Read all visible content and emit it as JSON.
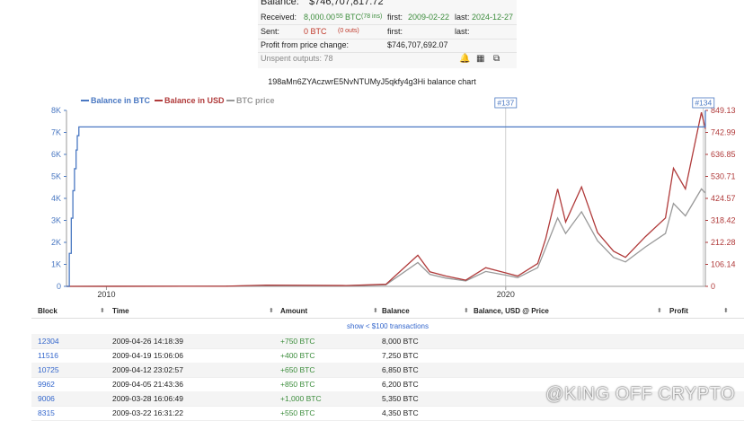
{
  "summary": {
    "balance_label": "Balance:",
    "balance_value": "$746,707,817.72",
    "received_label": "Received:",
    "received_value": "8,000.00",
    "received_suffix": "55",
    "received_unit": "BTC",
    "received_ins": "(78 ins)",
    "received_first_label": "first:",
    "received_first": "2009-02-22",
    "received_last_label": "last:",
    "received_last": "2024-12-27",
    "sent_label": "Sent:",
    "sent_value": "0 BTC",
    "sent_outs": "(0 outs)",
    "sent_first_label": "first:",
    "sent_last_label": "last:",
    "profit_label": "Profit from price change:",
    "profit_value": "$746,707,692.07",
    "unspent_label": "Unspent outputs: 78",
    "icons": [
      "bell-icon",
      "qr-code-icon",
      "copy-icon"
    ],
    "icon_glyphs": [
      "🔔",
      "▦",
      "⧉"
    ]
  },
  "chart_title": "198aMn6ZYAczwrE5NvNTUMyJ5qkfy4g3Hi balance chart",
  "chart_data": {
    "type": "line",
    "legend": [
      {
        "name": "Balance in BTC",
        "color": "#4a78c2"
      },
      {
        "name": "Balance in USD",
        "color": "#b03a3a"
      },
      {
        "name": "BTC price",
        "color": "#999999"
      }
    ],
    "legend_placement": "top-left",
    "x_ticks": [
      "2010",
      "2020"
    ],
    "x_range": [
      2009.0,
      2025.0
    ],
    "y_left_ticks": [
      "0",
      "1K",
      "2K",
      "3K",
      "4K",
      "5K",
      "6K",
      "7K",
      "8K"
    ],
    "y_left_range": [
      0,
      8000
    ],
    "y_right_ticks": [
      "0",
      "106.14",
      "212.28",
      "318.42",
      "424.57",
      "530.71",
      "636.85",
      "742.99",
      "849.13"
    ],
    "y_right_range": [
      0,
      849.13
    ],
    "y_right_unit": "M",
    "annotations": [
      "#137",
      "#134"
    ],
    "annotation_x": [
      2020.0,
      2024.95
    ],
    "grid": false,
    "series": [
      {
        "name": "Balance in BTC",
        "axis": "left",
        "x": [
          2009.0,
          2009.07,
          2009.12,
          2009.16,
          2009.2,
          2009.24,
          2009.27,
          2009.31,
          2025.0
        ],
        "values": [
          0,
          1500,
          3100,
          4350,
          5350,
          6200,
          6850,
          7250,
          8000
        ]
      },
      {
        "name": "Balance in USD",
        "axis": "right",
        "x": [
          2009.0,
          2012.0,
          2013.0,
          2014.0,
          2016.0,
          2017.0,
          2017.8,
          2018.1,
          2018.5,
          2019.0,
          2019.5,
          2020.0,
          2020.3,
          2020.8,
          2021.0,
          2021.3,
          2021.5,
          2021.9,
          2022.3,
          2022.7,
          2023.0,
          2023.5,
          2024.0,
          2024.2,
          2024.5,
          2024.9,
          2025.0
        ],
        "values": [
          0,
          0.5,
          1,
          6,
          4,
          10,
          150,
          70,
          50,
          30,
          90,
          65,
          50,
          110,
          230,
          470,
          310,
          480,
          260,
          170,
          140,
          240,
          330,
          570,
          470,
          840,
          760
        ]
      },
      {
        "name": "BTC price",
        "axis": "right",
        "x": [
          2009.0,
          2012.0,
          2013.0,
          2014.0,
          2016.0,
          2017.0,
          2017.8,
          2018.1,
          2018.5,
          2019.0,
          2019.5,
          2020.0,
          2020.3,
          2020.8,
          2021.0,
          2021.3,
          2021.5,
          2021.9,
          2022.3,
          2022.7,
          2023.0,
          2023.5,
          2024.0,
          2024.2,
          2024.5,
          2024.9,
          2025.0
        ],
        "values": [
          0,
          0.4,
          0.8,
          4,
          3,
          8,
          115,
          58,
          40,
          26,
          72,
          54,
          42,
          90,
          185,
          330,
          255,
          360,
          220,
          140,
          118,
          190,
          255,
          400,
          340,
          470,
          450
        ]
      }
    ]
  },
  "table": {
    "headers": [
      "Block",
      "Time",
      "Amount",
      "Balance",
      "Balance, USD @ Price",
      "Profit"
    ],
    "show_link": "show < $100 transactions",
    "rows": [
      {
        "block": "12304",
        "time": "2009-04-26 14:18:39",
        "amount": "+750 BTC",
        "balance": "8,000 BTC"
      },
      {
        "block": "11516",
        "time": "2009-04-19 15:06:06",
        "amount": "+400 BTC",
        "balance": "7,250 BTC"
      },
      {
        "block": "10725",
        "time": "2009-04-12 23:02:57",
        "amount": "+650 BTC",
        "balance": "6,850 BTC"
      },
      {
        "block": "9962",
        "time": "2009-04-05 21:43:36",
        "amount": "+850 BTC",
        "balance": "6,200 BTC"
      },
      {
        "block": "9006",
        "time": "2009-03-28 16:06:49",
        "amount": "+1,000 BTC",
        "balance": "5,350 BTC"
      },
      {
        "block": "8315",
        "time": "2009-03-22 16:31:22",
        "amount": "+550 BTC",
        "balance": "4,350 BTC"
      }
    ]
  },
  "watermark": "@KING OFF CRYPTO"
}
